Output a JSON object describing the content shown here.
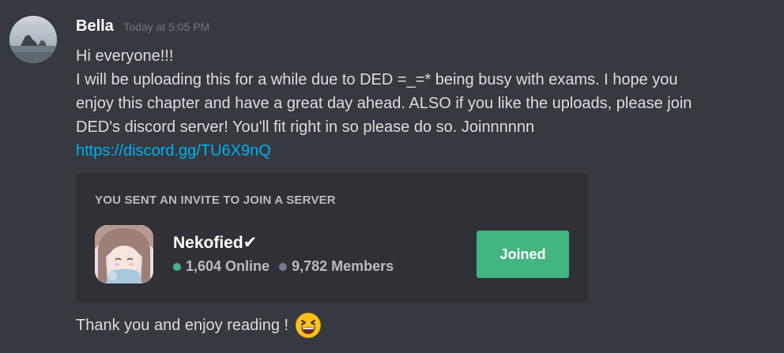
{
  "message": {
    "username": "Bella",
    "timestamp": "Today at 5:05 PM",
    "lines": [
      "Hi everyone!!!",
      "I will be uploading this for a while due to DED =_=* being busy with exams. I hope you",
      "enjoy this chapter and have a great day ahead. ALSO if you like the uploads, please join",
      "DED's discord server! You'll fit right in so please do so. Joinnnnnn"
    ],
    "link": "https://discord.gg/TU6X9nQ",
    "closing_text": "Thank you and enjoy reading !",
    "closing_emoji": "laughing-emoji"
  },
  "invite": {
    "header": "YOU SENT AN INVITE TO JOIN A SERVER",
    "server_name": "Nekofied✔",
    "online_count": "1,604 Online",
    "member_count": "9,782 Members",
    "button_label": "Joined",
    "online_color": "#43b581",
    "button_color": "#43b581"
  },
  "colors": {
    "background": "#36393f",
    "embed_background": "#2f3136",
    "link": "#00b0f4",
    "username": "#ffffff",
    "timestamp": "#72767d"
  }
}
